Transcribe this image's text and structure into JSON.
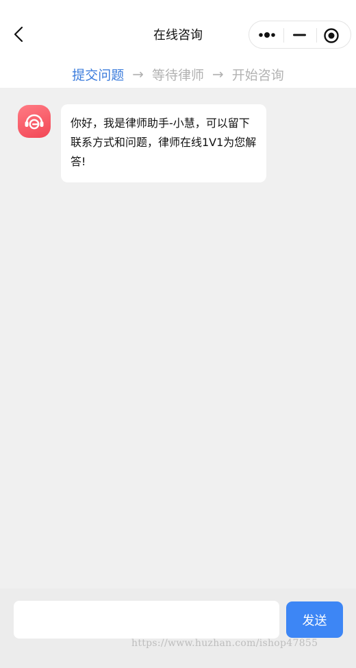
{
  "navbar": {
    "title": "在线咨询",
    "back_icon": "chevron-left-icon",
    "capsule": {
      "more_icon": "more-dots-icon",
      "minimize_icon": "minimize-icon",
      "close_icon": "target-close-icon"
    }
  },
  "steps": {
    "items": [
      "提交问题",
      "等待律师",
      "开始咨询"
    ],
    "arrow": "→",
    "active_index": 0,
    "active_color": "#3b7cdc",
    "inactive_color": "#b2b2b2"
  },
  "chat": {
    "messages": [
      {
        "sender_icon": "customer-service-headset-icon",
        "text": "你好，我是律师助手-小慧，可以留下联系方式和问题，律师在线1V1为您解答!"
      }
    ]
  },
  "composer": {
    "input_value": "",
    "input_placeholder": "",
    "send_label": "发送",
    "send_color": "#3d86f5"
  },
  "watermark": "https://www.huzhan.com/ishop47855"
}
